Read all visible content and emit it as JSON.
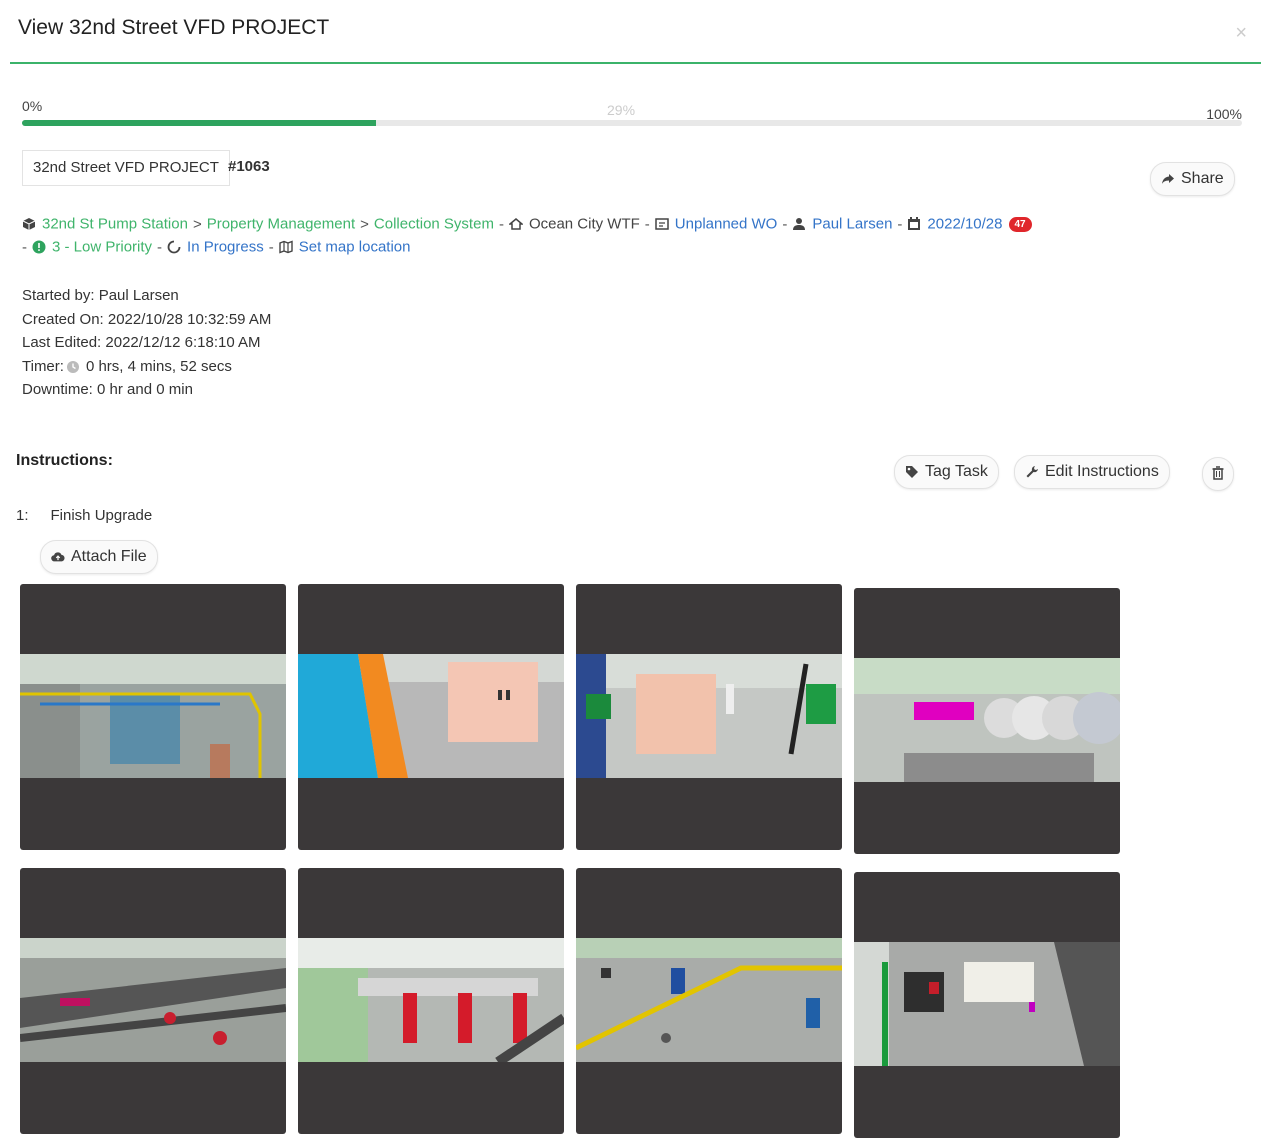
{
  "modal": {
    "title": "View 32nd Street VFD PROJECT",
    "close_label": "×"
  },
  "progress": {
    "start_label": "0%",
    "current_label": "29%",
    "end_label": "100%",
    "value_percent": 29
  },
  "work_order": {
    "name": "32nd Street VFD PROJECT",
    "number": "#1063"
  },
  "share_label": "Share",
  "breadcrumb": {
    "items": [
      "32nd St Pump Station",
      "Property Management",
      "Collection System"
    ],
    "separator": ">",
    "facility": "Ocean City WTF",
    "type": "Unplanned WO",
    "assignee": "Paul Larsen",
    "due_date": "2022/10/28",
    "due_badge": "47",
    "priority": "3 - Low Priority",
    "status": "In Progress",
    "map_link": "Set map location"
  },
  "meta": {
    "started_by": "Started by: Paul Larsen",
    "created_on": "Created On: 2022/10/28 10:32:59 AM",
    "last_edited": "Last Edited: 2022/12/12 6:18:10 AM",
    "timer_label": "Timer:",
    "timer_value": "0 hrs, 4 mins, 52 secs",
    "downtime": "Downtime: 0 hr and 0 min"
  },
  "instructions": {
    "heading": "Instructions:",
    "tag_task_label": "Tag Task",
    "edit_label": "Edit Instructions",
    "steps": [
      {
        "num": "1:",
        "text": "Finish Upgrade"
      }
    ],
    "attach_label": "Attach File"
  },
  "colors": {
    "accent_green": "#3bb36a",
    "link_blue": "#3474c8",
    "badge_red": "#e0262b",
    "thumb_frame": "#3b3839"
  }
}
